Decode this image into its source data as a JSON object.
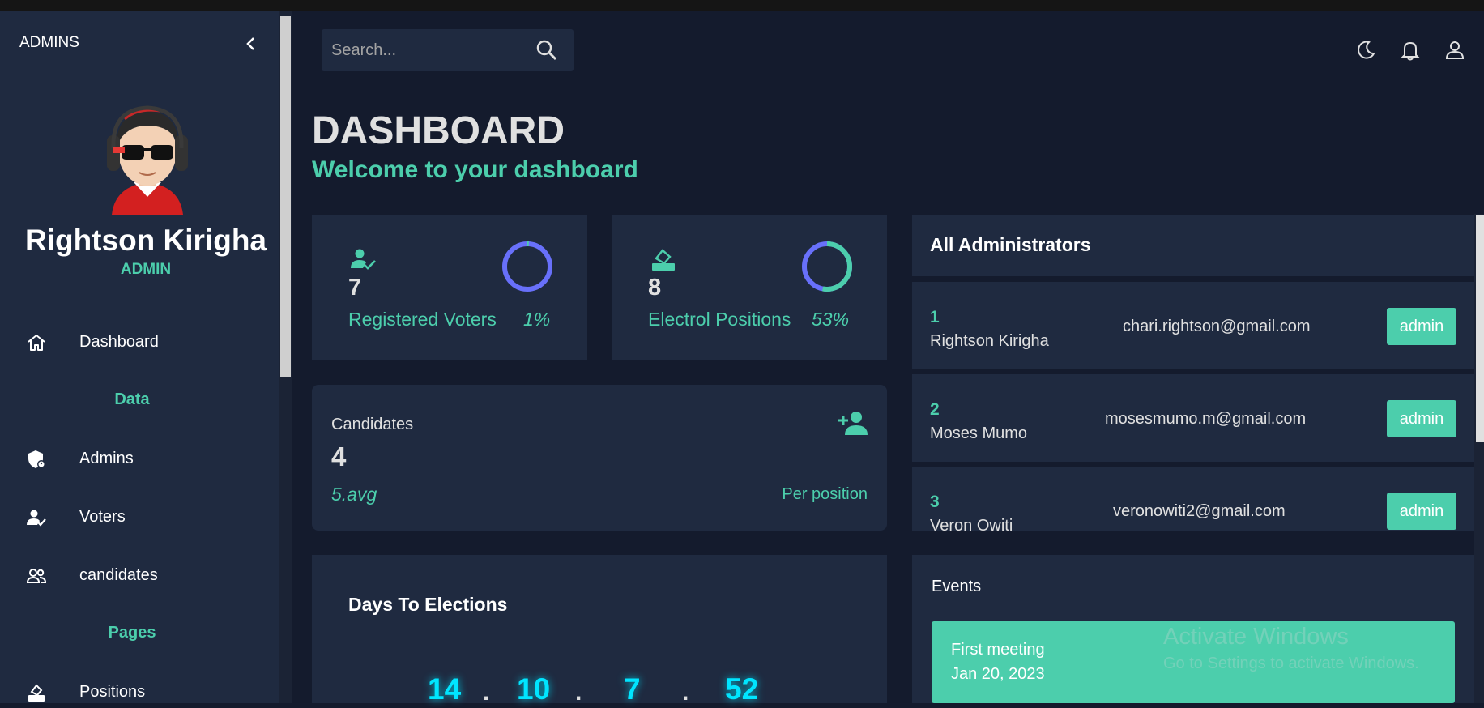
{
  "sidebar": {
    "header": "ADMINS",
    "user_name": "Rightson Kirigha",
    "user_role": "ADMIN",
    "items": [
      {
        "label": "Dashboard",
        "icon": "home-icon"
      },
      {
        "label": "Admins",
        "icon": "shield-icon"
      },
      {
        "label": "Voters",
        "icon": "person-check-icon"
      },
      {
        "label": "candidates",
        "icon": "people-icon"
      },
      {
        "label": "Positions",
        "icon": "ballot-icon"
      }
    ],
    "sections": [
      "Data",
      "Pages"
    ]
  },
  "search": {
    "placeholder": "Search..."
  },
  "page": {
    "title": "DASHBOARD",
    "subtitle": "Welcome to your dashboard"
  },
  "stats": [
    {
      "value": "7",
      "label": "Registered Voters",
      "percent": "1%",
      "progress": 0.01
    },
    {
      "value": "8",
      "label": "Electrol Positions",
      "percent": "53%",
      "progress": 0.53
    }
  ],
  "candidates": {
    "title": "Candidates",
    "value": "4",
    "avg": "5.avg",
    "note": "Per position"
  },
  "administrators": {
    "title": "All Administrators",
    "rows": [
      {
        "num": "1",
        "name": "Rightson Kirigha",
        "email": "chari.rightson@gmail.com",
        "role": "admin"
      },
      {
        "num": "2",
        "name": "Moses Mumo",
        "email": "mosesmumo.m@gmail.com",
        "role": "admin"
      },
      {
        "num": "3",
        "name": "Veron Owiti",
        "email": "veronowiti2@gmail.com",
        "role": "admin"
      }
    ]
  },
  "countdown": {
    "title": "Days To Elections",
    "values": [
      "14",
      "10",
      "7",
      "52"
    ],
    "sep": "."
  },
  "events": {
    "title": "Events",
    "items": [
      {
        "title": "First meeting",
        "date": "Jan 20, 2023"
      }
    ]
  },
  "watermark": {
    "line1": "Activate Windows",
    "line2": "Go to Settings to activate Windows."
  },
  "colors": {
    "accent": "#4cceac",
    "panel": "#1f2a40",
    "background": "#141b2d",
    "ring": "#6870fa",
    "countdown": "#00e5ff"
  }
}
